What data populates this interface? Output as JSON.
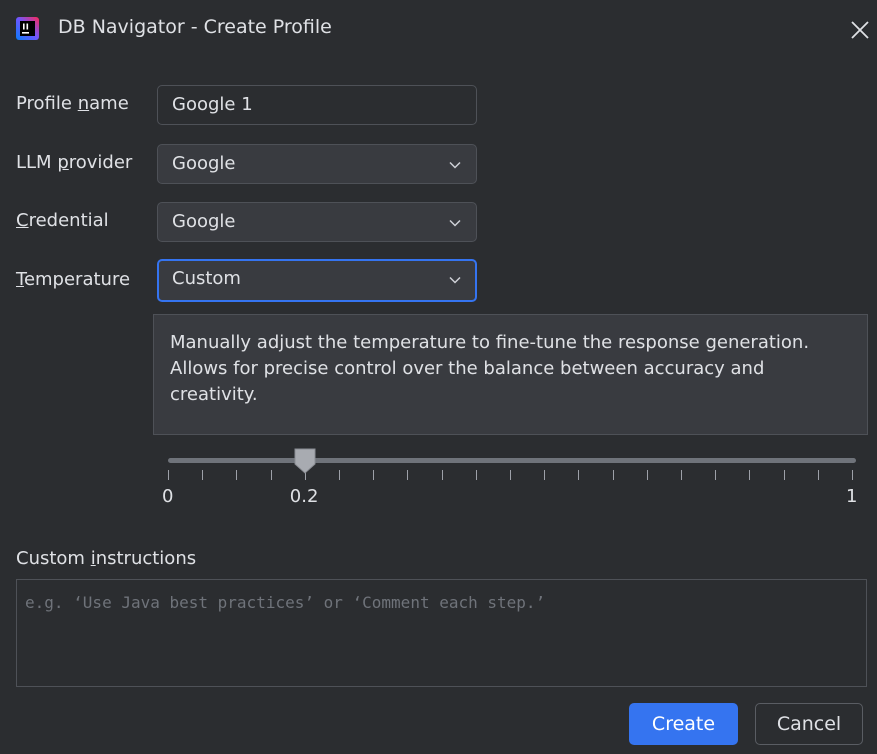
{
  "window": {
    "title": "DB Navigator - Create Profile",
    "icon": "jetbrains-app-icon",
    "close_icon": "close-icon"
  },
  "form": {
    "profile_name": {
      "label_pre": "Profile ",
      "label_mn": "n",
      "label_post": "ame",
      "value": "Google 1"
    },
    "llm_provider": {
      "label_pre": "LLM ",
      "label_mn": "p",
      "label_post": "rovider",
      "value": "Google"
    },
    "credential": {
      "label_pre": "",
      "label_mn": "C",
      "label_post": "redential",
      "value": "Google"
    },
    "temperature": {
      "label_pre": "",
      "label_mn": "T",
      "label_post": "emperature",
      "value": "Custom",
      "description": "Manually adjust the temperature to fine-tune the response generation. Allows for precise control over the balance between accuracy and creativity.",
      "slider": {
        "min": 0,
        "max": 1,
        "value": 0.2,
        "min_label": "0",
        "value_label": "0.2",
        "max_label": "1",
        "ticks": 21
      }
    },
    "custom_instructions": {
      "label_pre": "Custom ",
      "label_mn": "i",
      "label_post": "nstructions",
      "value": "",
      "placeholder": "e.g. ‘Use Java best practices’ or ‘Comment each step.’"
    }
  },
  "buttons": {
    "create": "Create",
    "cancel": "Cancel"
  },
  "colors": {
    "background": "#2b2d30",
    "accent": "#3574f0",
    "field": "#393b40",
    "border": "#4e5157"
  }
}
